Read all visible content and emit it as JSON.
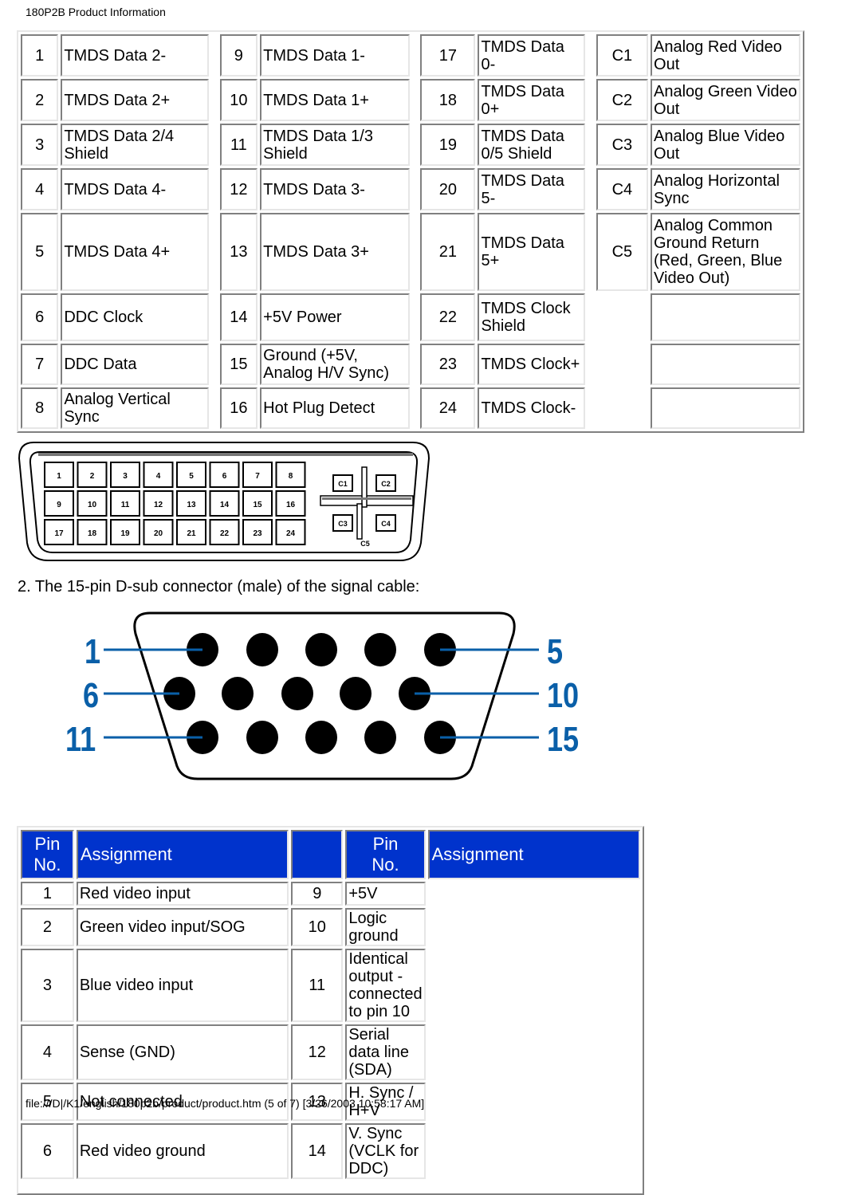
{
  "header": {
    "title": "180P2B Product Information"
  },
  "dvi_pins": {
    "rows": [
      [
        {
          "pin": "1",
          "name": "TMDS Data 2-"
        },
        {
          "pin": "9",
          "name": "TMDS Data 1-"
        },
        {
          "pin": "17",
          "name": "TMDS Data 0-"
        },
        {
          "pin": "C1",
          "name": "Analog Red Video Out"
        }
      ],
      [
        {
          "pin": "2",
          "name": "TMDS Data 2+"
        },
        {
          "pin": "10",
          "name": "TMDS Data 1+"
        },
        {
          "pin": "18",
          "name": "TMDS Data 0+"
        },
        {
          "pin": "C2",
          "name": "Analog Green Video Out"
        }
      ],
      [
        {
          "pin": "3",
          "name": "TMDS Data 2/4 Shield"
        },
        {
          "pin": "11",
          "name": "TMDS Data 1/3 Shield"
        },
        {
          "pin": "19",
          "name": "TMDS Data 0/5 Shield"
        },
        {
          "pin": "C3",
          "name": "Analog Blue Video Out"
        }
      ],
      [
        {
          "pin": "4",
          "name": "TMDS Data 4-"
        },
        {
          "pin": "12",
          "name": "TMDS Data 3-"
        },
        {
          "pin": "20",
          "name": "TMDS Data 5-"
        },
        {
          "pin": "C4",
          "name": "Analog Horizontal Sync"
        }
      ],
      [
        {
          "pin": "5",
          "name": "TMDS Data 4+"
        },
        {
          "pin": "13",
          "name": "TMDS Data 3+"
        },
        {
          "pin": "21",
          "name": "TMDS Data 5+"
        },
        {
          "pin": "C5",
          "name": "Analog Common Ground Return (Red, Green, Blue Video Out)"
        }
      ],
      [
        {
          "pin": "6",
          "name": "DDC Clock"
        },
        {
          "pin": "14",
          "name": "+5V Power"
        },
        {
          "pin": "22",
          "name": "TMDS Clock Shield"
        },
        {
          "pin": "",
          "name": ""
        }
      ],
      [
        {
          "pin": "7",
          "name": "DDC Data"
        },
        {
          "pin": "15",
          "name": "Ground (+5V, Analog H/V Sync)"
        },
        {
          "pin": "23",
          "name": "TMDS Clock+"
        },
        {
          "pin": "",
          "name": ""
        }
      ],
      [
        {
          "pin": "8",
          "name": "Analog Vertical Sync"
        },
        {
          "pin": "16",
          "name": "Hot Plug Detect"
        },
        {
          "pin": "24",
          "name": "TMDS Clock-"
        },
        {
          "pin": "",
          "name": ""
        }
      ]
    ]
  },
  "dvi_connector": {
    "pin_labels": [
      "1",
      "2",
      "3",
      "4",
      "5",
      "6",
      "7",
      "8",
      "9",
      "10",
      "11",
      "12",
      "13",
      "14",
      "15",
      "16",
      "17",
      "18",
      "19",
      "20",
      "21",
      "22",
      "23",
      "24"
    ],
    "analog_labels": [
      "C1",
      "C2",
      "C3",
      "C4",
      "C5"
    ]
  },
  "caption": "2. The 15-pin D-sub connector (male) of the signal cable:",
  "vga_connector": {
    "callouts": [
      "1",
      "6",
      "11",
      "5",
      "10",
      "15"
    ],
    "callout_color": "#0a5fa8"
  },
  "vga_pins": {
    "header_pin": "Pin No.",
    "header_pin_line1": "Pin",
    "header_pin_line2": "No.",
    "header_assignment": "Assignment",
    "header_color": "#0033cc",
    "rows": [
      [
        {
          "pin": "1",
          "name": "Red video input"
        },
        {
          "pin": "9",
          "name": "+5V"
        }
      ],
      [
        {
          "pin": "2",
          "name": "Green video input/SOG"
        },
        {
          "pin": "10",
          "name": "Logic ground"
        }
      ],
      [
        {
          "pin": "3",
          "name": "Blue video input"
        },
        {
          "pin": "11",
          "name": "Identical output - connected to pin 10"
        }
      ],
      [
        {
          "pin": "4",
          "name": "Sense (GND)"
        },
        {
          "pin": "12",
          "name": "Serial data line (SDA)"
        }
      ],
      [
        {
          "pin": "5",
          "name": "Not connected"
        },
        {
          "pin": "13",
          "name": "H. Sync / H+V"
        }
      ],
      [
        {
          "pin": "6",
          "name": "Red video ground"
        },
        {
          "pin": "14",
          "name": "V. Sync (VCLK for DDC)"
        }
      ]
    ]
  },
  "footer": {
    "text": "file:///D|/K1/english/180p2b/product/product.htm (5 of 7) [3/26/2003 10:58:17 AM]"
  }
}
